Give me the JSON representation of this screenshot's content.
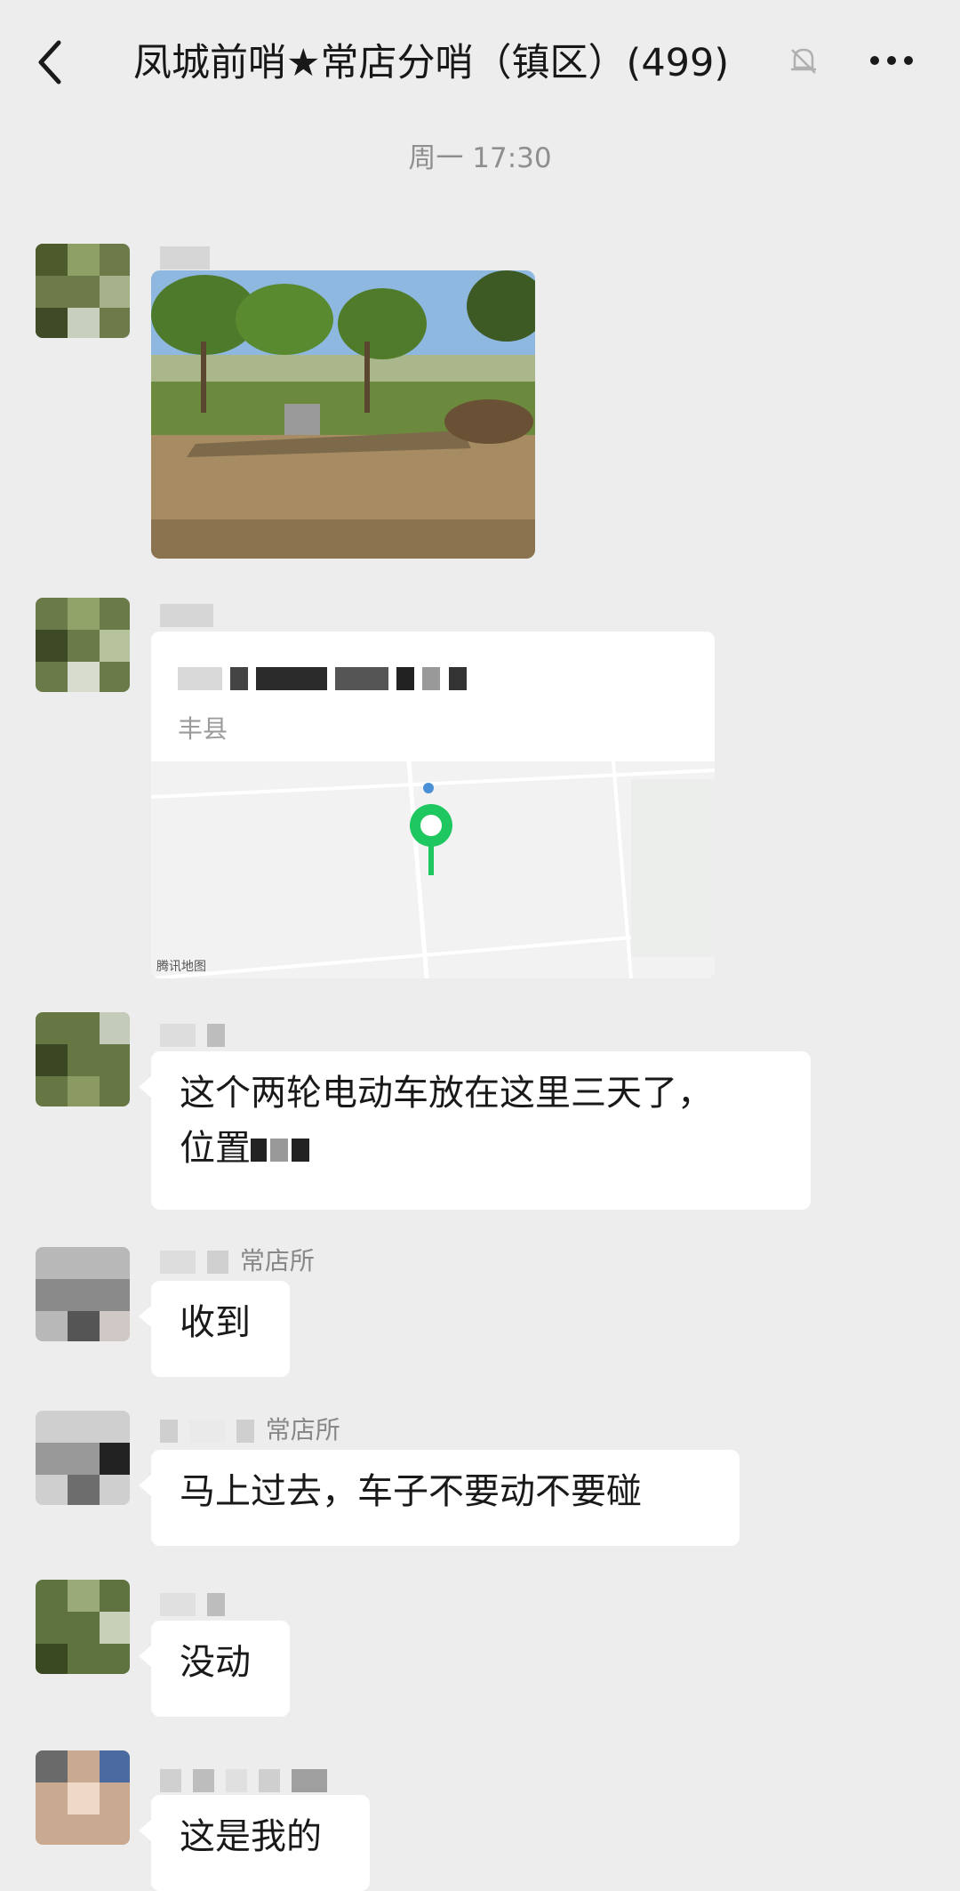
{
  "header": {
    "title": "凤城前哨★常店分哨（镇区）(499)",
    "back_icon": "chevron-left-icon",
    "mute_icon": "bell-off-icon",
    "more_icon": "more-dots-icon"
  },
  "timestamp": "周一 17:30",
  "location": {
    "address": "丰县",
    "map_credit": "腾讯地图",
    "pin_color": "#1ec760"
  },
  "messages": [
    {
      "type": "image"
    },
    {
      "type": "location"
    },
    {
      "type": "text",
      "text": "这个两轮电动车放在这里三天了，",
      "text2": "位置"
    },
    {
      "type": "text",
      "sender_suffix": "常店所",
      "text": "收到"
    },
    {
      "type": "text",
      "sender_suffix": "常店所",
      "text": "马上过去，车子不要动不要碰"
    },
    {
      "type": "text",
      "text": "没动"
    },
    {
      "type": "text",
      "text": "这是我的"
    }
  ],
  "colors": {
    "background": "#ededed",
    "bubble": "#ffffff",
    "title": "#181818",
    "meta": "#8f8f8f"
  }
}
